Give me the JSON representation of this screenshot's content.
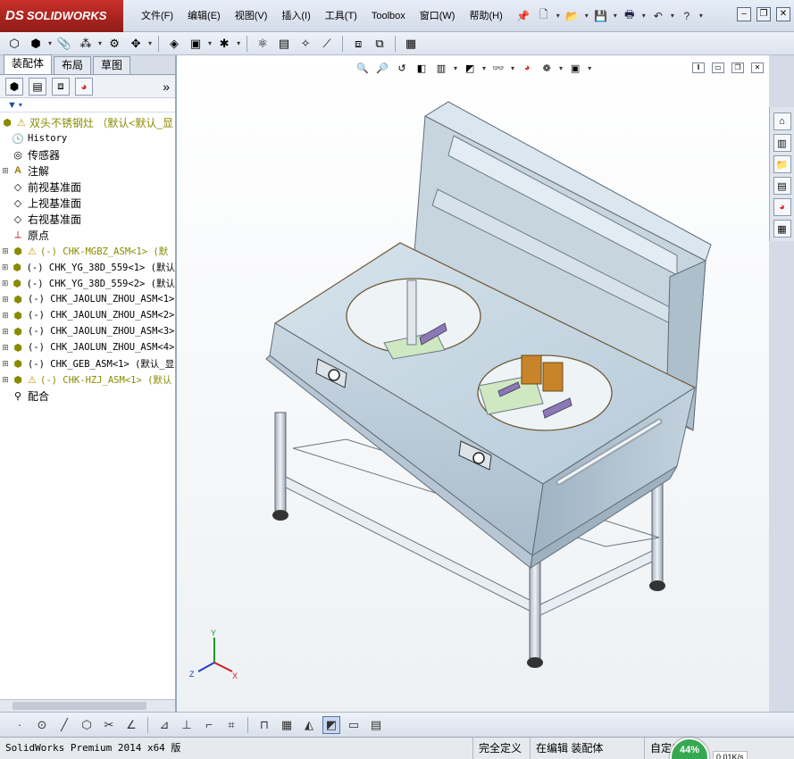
{
  "app": {
    "logo_ds": "DS",
    "logo_text": "SOLIDWORKS"
  },
  "menu": [
    "文件(F)",
    "编辑(E)",
    "视图(V)",
    "插入(I)",
    "工具(T)",
    "Toolbox",
    "窗口(W)",
    "帮助(H)"
  ],
  "panel": {
    "tabs": [
      "装配体",
      "布局",
      "草图"
    ],
    "chevron": "»"
  },
  "tree": {
    "root": "双头不锈钢灶  （默认<默认_显",
    "items": [
      {
        "label": "History",
        "mono": true
      },
      {
        "label": "传感器"
      },
      {
        "label": "注解"
      },
      {
        "label": "前视基准面"
      },
      {
        "label": "上视基准面"
      },
      {
        "label": "右视基准面"
      },
      {
        "label": "原点"
      },
      {
        "label": "(-) CHK-MGBZ_ASM<1> (默",
        "mono": true,
        "warn": true,
        "olive": true
      },
      {
        "label": "(-) CHK_YG_38D_559<1> (默认",
        "mono": true
      },
      {
        "label": "(-) CHK_YG_38D_559<2> (默认",
        "mono": true
      },
      {
        "label": "(-) CHK_JAOLUN_ZHOU_ASM<1>",
        "mono": true
      },
      {
        "label": "(-) CHK_JAOLUN_ZHOU_ASM<2>",
        "mono": true
      },
      {
        "label": "(-) CHK_JAOLUN_ZHOU_ASM<3>",
        "mono": true
      },
      {
        "label": "(-) CHK_JAOLUN_ZHOU_ASM<4>",
        "mono": true
      },
      {
        "label": "(-) CHK_GEB_ASM<1> (默认_显",
        "mono": true
      },
      {
        "label": "(-) CHK-HZJ_ASM<1> (默认",
        "mono": true,
        "warn": true,
        "olive": true
      },
      {
        "label": "配合"
      }
    ]
  },
  "triad": {
    "x": "X",
    "y": "Y",
    "z": "Z"
  },
  "status": {
    "product": "SolidWorks Premium 2014 x64 版",
    "defined": "完全定义",
    "editing": "在编辑 装配体",
    "custom": "自定义",
    "net_percent": "44%",
    "net_speed": "0.01K/s"
  },
  "colors": {
    "logo_red": "#b32520",
    "warning": "#c99a00",
    "model_body": "#b9ccd8"
  }
}
